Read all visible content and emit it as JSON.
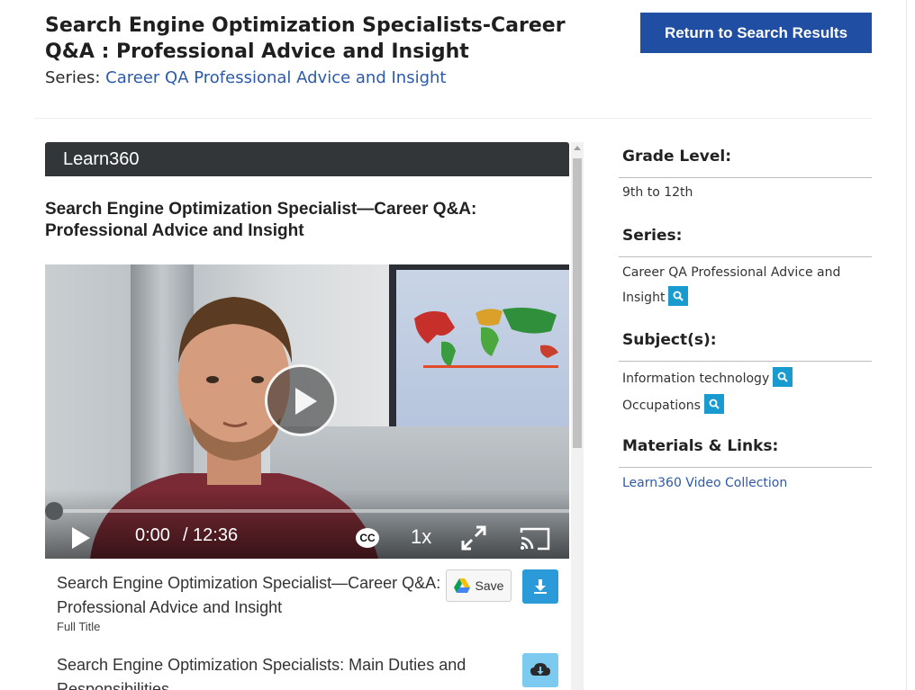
{
  "header": {
    "title": "Search Engine Optimization Specialists-Career Q&A : Professional Advice and Insight",
    "series_label": "Series:",
    "series_link": "Career QA Professional Advice and Insight",
    "return_button": "Return to Search Results"
  },
  "player": {
    "brand": "Learn360",
    "video_title": "Search Engine Optimization Specialist—Career Q&A: Professional Advice and Insight",
    "current_time": "0:00",
    "duration": "/ 12:36",
    "cc_label": "CC",
    "speed": "1x",
    "progress_fraction": 0.0,
    "rows": [
      {
        "title": "Search Engine Optimization Specialist—Career Q&A: Professional Advice and Insight",
        "subtitle": "Full Title",
        "save_label": "Save"
      },
      {
        "title": "Search Engine Optimization Specialists: Main Duties and Responsibilities"
      }
    ]
  },
  "sidebar": {
    "grade_heading": "Grade Level:",
    "grade_value": "9th to 12th",
    "series_heading": "Series:",
    "series_value": "Career QA Professional Advice and Insight",
    "subjects_heading": "Subject(s):",
    "subjects": [
      "Information technology",
      "Occupations"
    ],
    "materials_heading": "Materials & Links:",
    "materials_link": "Learn360 Video Collection"
  },
  "colors": {
    "primary_button": "#1f4ea3",
    "link": "#2d5aa8",
    "search_chip": "#1a9bd0",
    "download_button": "#2b9ad9",
    "player_header": "#333638"
  }
}
